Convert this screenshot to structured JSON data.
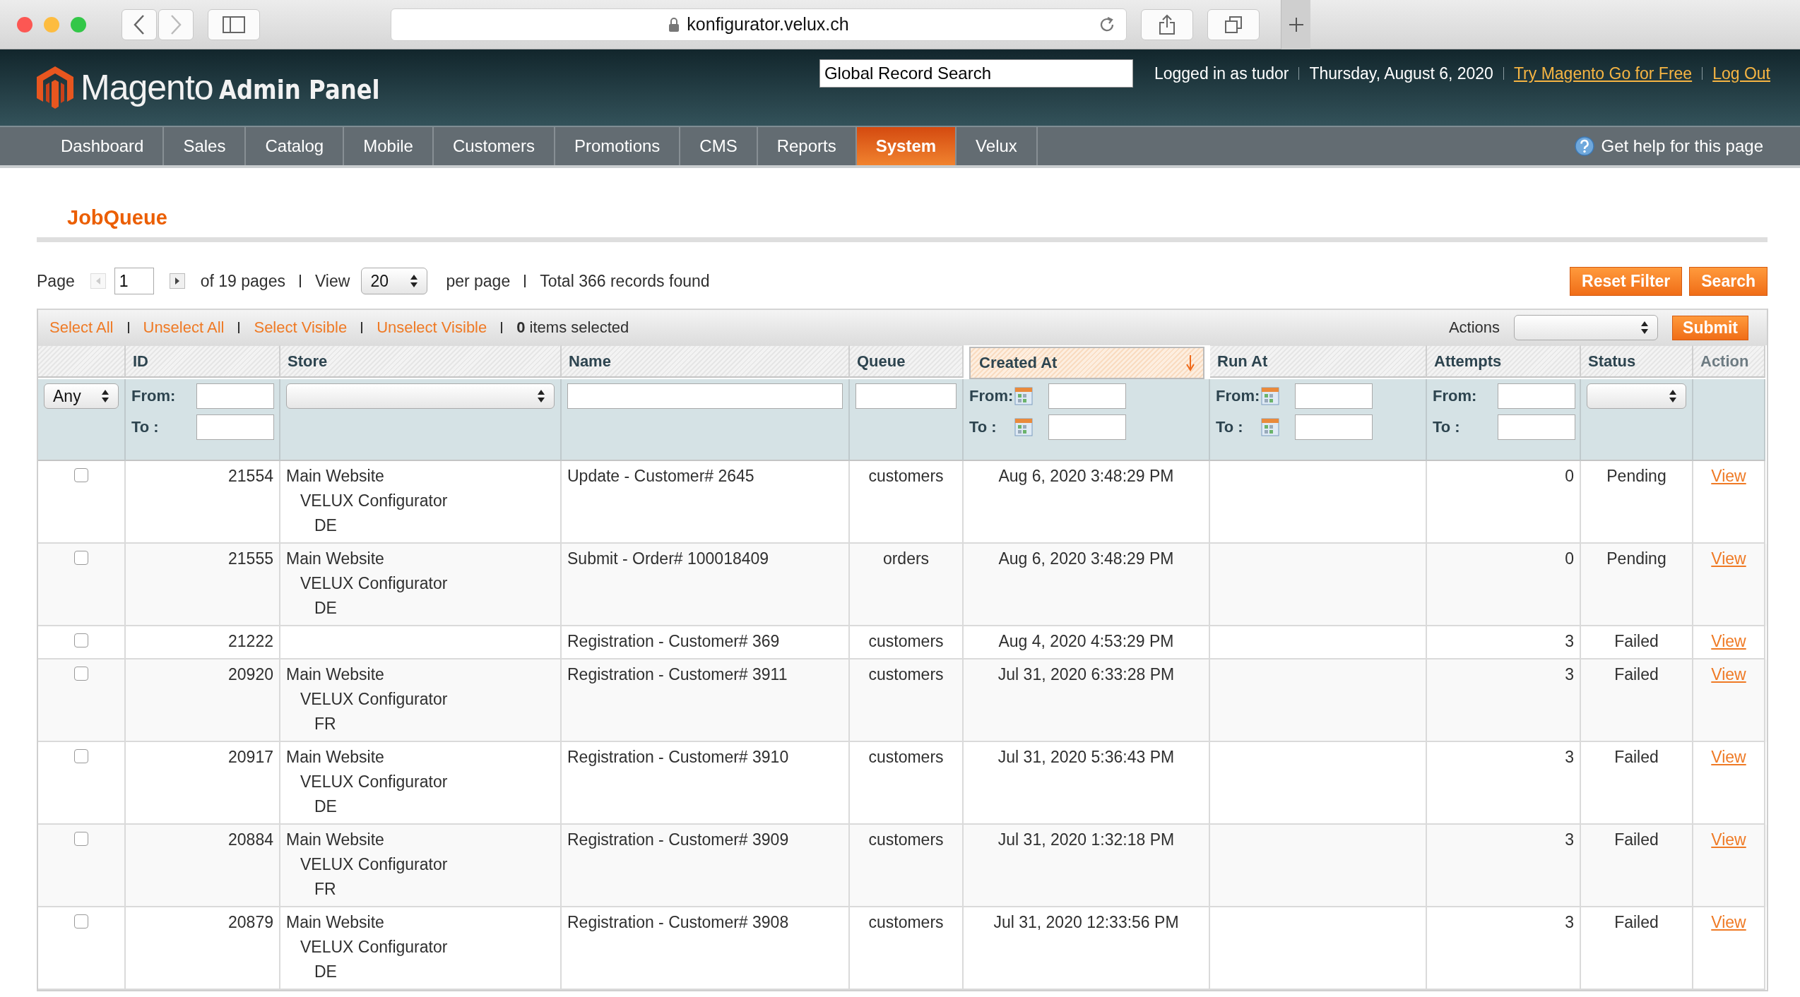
{
  "browser": {
    "url": "konfigurator.velux.ch"
  },
  "header": {
    "logo": "Magento",
    "logo_suffix": "Admin Panel",
    "search": {
      "placeholder": "Global Record Search"
    },
    "user": "Logged in as tudor",
    "date": "Thursday, August 6, 2020",
    "links": [
      "Try Magento Go for Free",
      "Log Out"
    ]
  },
  "nav": {
    "items": [
      {
        "label": "Dashboard",
        "selected": false
      },
      {
        "label": "Sales",
        "selected": false
      },
      {
        "label": "Catalog",
        "selected": false
      },
      {
        "label": "Mobile",
        "selected": false
      },
      {
        "label": "Customers",
        "selected": false
      },
      {
        "label": "Promotions",
        "selected": false
      },
      {
        "label": "CMS",
        "selected": false
      },
      {
        "label": "Reports",
        "selected": false
      },
      {
        "label": "System",
        "selected": true
      },
      {
        "label": "Velux",
        "selected": false
      }
    ],
    "help": "Get help for this page"
  },
  "title": "JobQueue",
  "pager": {
    "page_label": "Page",
    "page": "1",
    "pages": "of 19 pages",
    "view_label": "View",
    "per_page": "20",
    "per_page_label": "per page",
    "total": "Total 366 records found"
  },
  "buttons": [
    "Reset Filter",
    "Search"
  ],
  "massaction": {
    "links": [
      "Select All",
      "Unselect All",
      "Select Visible",
      "Unselect Visible"
    ],
    "count": "**0** items selected",
    "actions_label": "Actions",
    "submit": "Submit"
  },
  "columns": [
    {
      "sorted": false,
      "filter": {
        "kind": "select",
        "value": "Any"
      }
    },
    {
      "label": "ID",
      "sorted": false,
      "sortable": true,
      "filter": {
        "kind": "range",
        "from": "From:",
        "to": "To :"
      }
    },
    {
      "label": "Store",
      "sorted": false,
      "sortable": true,
      "filter": {
        "kind": "select"
      }
    },
    {
      "label": "Name",
      "sorted": false,
      "sortable": true,
      "filter": {
        "kind": "text"
      }
    },
    {
      "label": "Queue",
      "sorted": false,
      "sortable": true,
      "filter": {
        "kind": "text"
      }
    },
    {
      "label": "Created At",
      "sorted": true,
      "sortable": true,
      "filter": {
        "kind": "date",
        "from": "From:",
        "to": "To :"
      }
    },
    {
      "label": "Run At",
      "sorted": false,
      "sortable": true,
      "filter": {
        "kind": "date",
        "from": "From:",
        "to": "To :"
      }
    },
    {
      "label": "Attempts",
      "sorted": false,
      "sortable": true,
      "filter": {
        "kind": "range",
        "from": "From:",
        "to": "To :"
      }
    },
    {
      "label": "Status",
      "sorted": false,
      "sortable": true,
      "filter": {
        "kind": "select"
      }
    },
    {
      "label": "Action",
      "sorted": false,
      "sortable": false,
      "filter": {
        "kind": "none"
      }
    }
  ],
  "rows": [
    {
      "checked": false,
      "id": "21554",
      "store": [
        "Main Website",
        "VELUX Configurator",
        "DE"
      ],
      "name": "Update - Customer# 2645",
      "queue": "customers",
      "created_at": "Aug 6, 2020 3:48:29 PM",
      "attempts": "0",
      "status": "Pending",
      "action": "View"
    },
    {
      "checked": false,
      "id": "21555",
      "store": [
        "Main Website",
        "VELUX Configurator",
        "DE"
      ],
      "name": "Submit - Order# 100018409",
      "queue": "orders",
      "created_at": "Aug 6, 2020 3:48:29 PM",
      "attempts": "0",
      "status": "Pending",
      "action": "View"
    },
    {
      "checked": false,
      "id": "21222",
      "name": "Registration - Customer# 369",
      "queue": "customers",
      "created_at": "Aug 4, 2020 4:53:29 PM",
      "attempts": "3",
      "status": "Failed",
      "action": "View"
    },
    {
      "checked": false,
      "id": "20920",
      "store": [
        "Main Website",
        "VELUX Configurator",
        "FR"
      ],
      "name": "Registration - Customer# 3911",
      "queue": "customers",
      "created_at": "Jul 31, 2020 6:33:28 PM",
      "attempts": "3",
      "status": "Failed",
      "action": "View"
    },
    {
      "checked": false,
      "id": "20917",
      "store": [
        "Main Website",
        "VELUX Configurator",
        "DE"
      ],
      "name": "Registration - Customer# 3910",
      "queue": "customers",
      "created_at": "Jul 31, 2020 5:36:43 PM",
      "attempts": "3",
      "status": "Failed",
      "action": "View"
    },
    {
      "checked": false,
      "id": "20884",
      "store": [
        "Main Website",
        "VELUX Configurator",
        "FR"
      ],
      "name": "Registration - Customer# 3909",
      "queue": "customers",
      "created_at": "Jul 31, 2020 1:32:18 PM",
      "attempts": "3",
      "status": "Failed",
      "action": "View"
    },
    {
      "checked": false,
      "id": "20879",
      "store": [
        "Main Website",
        "VELUX Configurator",
        "DE"
      ],
      "name": "Registration - Customer# 3908",
      "queue": "customers",
      "created_at": "Jul 31, 2020 12:33:56 PM",
      "attempts": "3",
      "status": "Failed",
      "action": "View"
    }
  ]
}
